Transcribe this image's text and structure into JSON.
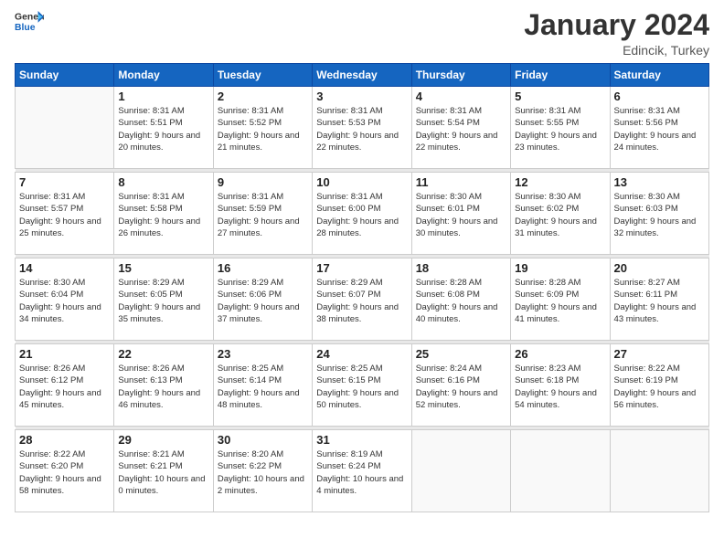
{
  "logo": {
    "general": "General",
    "blue": "Blue"
  },
  "header": {
    "month": "January 2024",
    "location": "Edincik, Turkey"
  },
  "weekdays": [
    "Sunday",
    "Monday",
    "Tuesday",
    "Wednesday",
    "Thursday",
    "Friday",
    "Saturday"
  ],
  "weeks": [
    [
      {
        "day": "",
        "sunrise": "",
        "sunset": "",
        "daylight": ""
      },
      {
        "day": "1",
        "sunrise": "Sunrise: 8:31 AM",
        "sunset": "Sunset: 5:51 PM",
        "daylight": "Daylight: 9 hours and 20 minutes."
      },
      {
        "day": "2",
        "sunrise": "Sunrise: 8:31 AM",
        "sunset": "Sunset: 5:52 PM",
        "daylight": "Daylight: 9 hours and 21 minutes."
      },
      {
        "day": "3",
        "sunrise": "Sunrise: 8:31 AM",
        "sunset": "Sunset: 5:53 PM",
        "daylight": "Daylight: 9 hours and 22 minutes."
      },
      {
        "day": "4",
        "sunrise": "Sunrise: 8:31 AM",
        "sunset": "Sunset: 5:54 PM",
        "daylight": "Daylight: 9 hours and 22 minutes."
      },
      {
        "day": "5",
        "sunrise": "Sunrise: 8:31 AM",
        "sunset": "Sunset: 5:55 PM",
        "daylight": "Daylight: 9 hours and 23 minutes."
      },
      {
        "day": "6",
        "sunrise": "Sunrise: 8:31 AM",
        "sunset": "Sunset: 5:56 PM",
        "daylight": "Daylight: 9 hours and 24 minutes."
      }
    ],
    [
      {
        "day": "7",
        "sunrise": "Sunrise: 8:31 AM",
        "sunset": "Sunset: 5:57 PM",
        "daylight": "Daylight: 9 hours and 25 minutes."
      },
      {
        "day": "8",
        "sunrise": "Sunrise: 8:31 AM",
        "sunset": "Sunset: 5:58 PM",
        "daylight": "Daylight: 9 hours and 26 minutes."
      },
      {
        "day": "9",
        "sunrise": "Sunrise: 8:31 AM",
        "sunset": "Sunset: 5:59 PM",
        "daylight": "Daylight: 9 hours and 27 minutes."
      },
      {
        "day": "10",
        "sunrise": "Sunrise: 8:31 AM",
        "sunset": "Sunset: 6:00 PM",
        "daylight": "Daylight: 9 hours and 28 minutes."
      },
      {
        "day": "11",
        "sunrise": "Sunrise: 8:30 AM",
        "sunset": "Sunset: 6:01 PM",
        "daylight": "Daylight: 9 hours and 30 minutes."
      },
      {
        "day": "12",
        "sunrise": "Sunrise: 8:30 AM",
        "sunset": "Sunset: 6:02 PM",
        "daylight": "Daylight: 9 hours and 31 minutes."
      },
      {
        "day": "13",
        "sunrise": "Sunrise: 8:30 AM",
        "sunset": "Sunset: 6:03 PM",
        "daylight": "Daylight: 9 hours and 32 minutes."
      }
    ],
    [
      {
        "day": "14",
        "sunrise": "Sunrise: 8:30 AM",
        "sunset": "Sunset: 6:04 PM",
        "daylight": "Daylight: 9 hours and 34 minutes."
      },
      {
        "day": "15",
        "sunrise": "Sunrise: 8:29 AM",
        "sunset": "Sunset: 6:05 PM",
        "daylight": "Daylight: 9 hours and 35 minutes."
      },
      {
        "day": "16",
        "sunrise": "Sunrise: 8:29 AM",
        "sunset": "Sunset: 6:06 PM",
        "daylight": "Daylight: 9 hours and 37 minutes."
      },
      {
        "day": "17",
        "sunrise": "Sunrise: 8:29 AM",
        "sunset": "Sunset: 6:07 PM",
        "daylight": "Daylight: 9 hours and 38 minutes."
      },
      {
        "day": "18",
        "sunrise": "Sunrise: 8:28 AM",
        "sunset": "Sunset: 6:08 PM",
        "daylight": "Daylight: 9 hours and 40 minutes."
      },
      {
        "day": "19",
        "sunrise": "Sunrise: 8:28 AM",
        "sunset": "Sunset: 6:09 PM",
        "daylight": "Daylight: 9 hours and 41 minutes."
      },
      {
        "day": "20",
        "sunrise": "Sunrise: 8:27 AM",
        "sunset": "Sunset: 6:11 PM",
        "daylight": "Daylight: 9 hours and 43 minutes."
      }
    ],
    [
      {
        "day": "21",
        "sunrise": "Sunrise: 8:26 AM",
        "sunset": "Sunset: 6:12 PM",
        "daylight": "Daylight: 9 hours and 45 minutes."
      },
      {
        "day": "22",
        "sunrise": "Sunrise: 8:26 AM",
        "sunset": "Sunset: 6:13 PM",
        "daylight": "Daylight: 9 hours and 46 minutes."
      },
      {
        "day": "23",
        "sunrise": "Sunrise: 8:25 AM",
        "sunset": "Sunset: 6:14 PM",
        "daylight": "Daylight: 9 hours and 48 minutes."
      },
      {
        "day": "24",
        "sunrise": "Sunrise: 8:25 AM",
        "sunset": "Sunset: 6:15 PM",
        "daylight": "Daylight: 9 hours and 50 minutes."
      },
      {
        "day": "25",
        "sunrise": "Sunrise: 8:24 AM",
        "sunset": "Sunset: 6:16 PM",
        "daylight": "Daylight: 9 hours and 52 minutes."
      },
      {
        "day": "26",
        "sunrise": "Sunrise: 8:23 AM",
        "sunset": "Sunset: 6:18 PM",
        "daylight": "Daylight: 9 hours and 54 minutes."
      },
      {
        "day": "27",
        "sunrise": "Sunrise: 8:22 AM",
        "sunset": "Sunset: 6:19 PM",
        "daylight": "Daylight: 9 hours and 56 minutes."
      }
    ],
    [
      {
        "day": "28",
        "sunrise": "Sunrise: 8:22 AM",
        "sunset": "Sunset: 6:20 PM",
        "daylight": "Daylight: 9 hours and 58 minutes."
      },
      {
        "day": "29",
        "sunrise": "Sunrise: 8:21 AM",
        "sunset": "Sunset: 6:21 PM",
        "daylight": "Daylight: 10 hours and 0 minutes."
      },
      {
        "day": "30",
        "sunrise": "Sunrise: 8:20 AM",
        "sunset": "Sunset: 6:22 PM",
        "daylight": "Daylight: 10 hours and 2 minutes."
      },
      {
        "day": "31",
        "sunrise": "Sunrise: 8:19 AM",
        "sunset": "Sunset: 6:24 PM",
        "daylight": "Daylight: 10 hours and 4 minutes."
      },
      {
        "day": "",
        "sunrise": "",
        "sunset": "",
        "daylight": ""
      },
      {
        "day": "",
        "sunrise": "",
        "sunset": "",
        "daylight": ""
      },
      {
        "day": "",
        "sunrise": "",
        "sunset": "",
        "daylight": ""
      }
    ]
  ]
}
